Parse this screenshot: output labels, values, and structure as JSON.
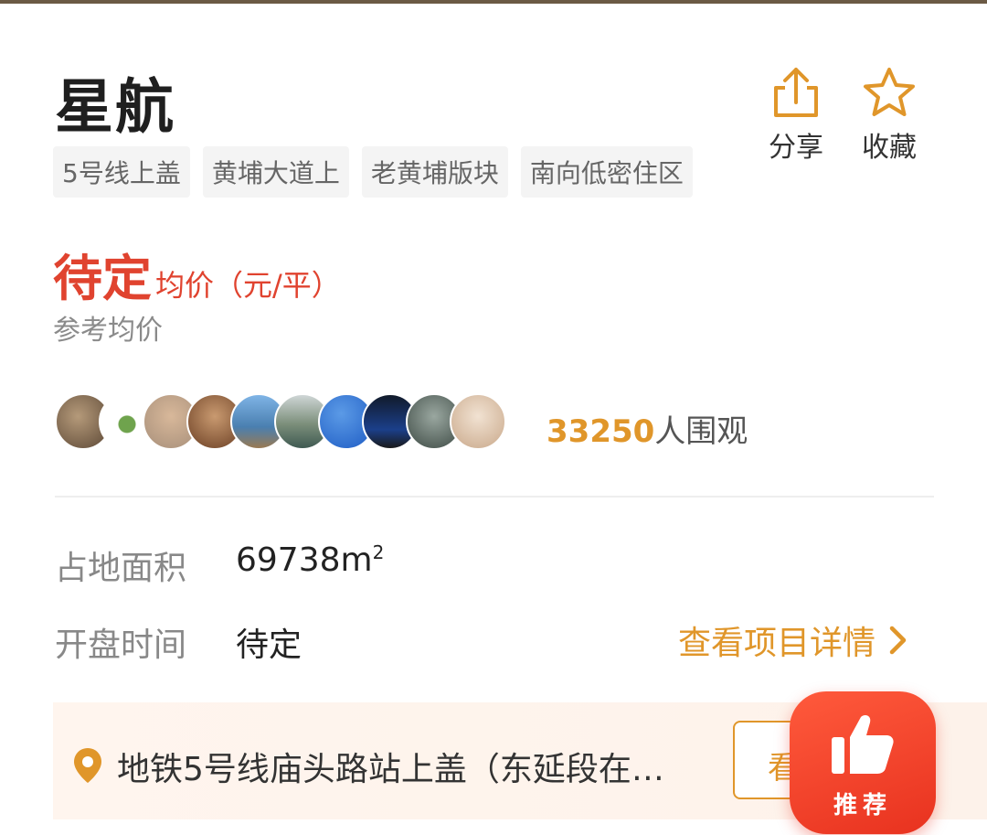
{
  "project": {
    "name": "星航",
    "tags": [
      "5号线上盖",
      "黄埔大道上",
      "老黄埔版块",
      "南向低密住区"
    ]
  },
  "actions": {
    "share_label": "分享",
    "favorite_label": "收藏"
  },
  "price": {
    "value": "待定",
    "unit": "均价（元/平）",
    "note": "参考均价"
  },
  "viewers": {
    "count": "33250",
    "suffix": "人围观",
    "avatar_count": 10
  },
  "info": [
    {
      "label": "占地面积",
      "value": "69738m",
      "sup": "2"
    },
    {
      "label": "开盘时间",
      "value": "待定"
    }
  ],
  "detail_link": "查看项目详情",
  "address": {
    "text": "地铁5号线庙头路站上盖（东延段在…",
    "button_label": "看"
  },
  "recommend_label": "推荐",
  "colors": {
    "price": "#e0432f",
    "accent": "#e0962a",
    "recommend": "#f0412a"
  }
}
